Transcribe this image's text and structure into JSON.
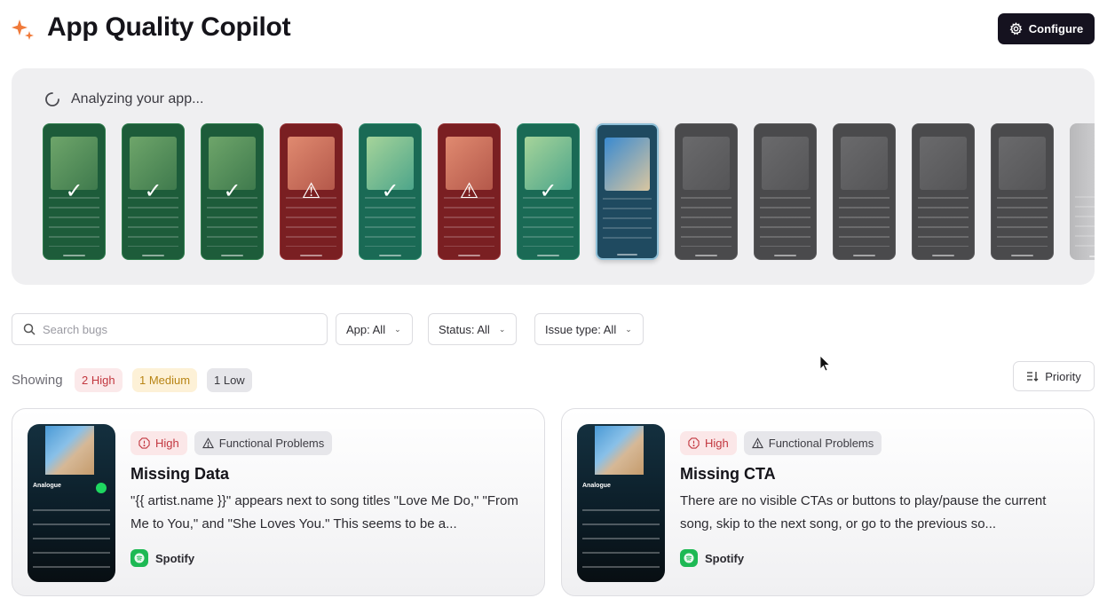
{
  "header": {
    "title": "App Quality Copilot",
    "logo_icon": "sparkle-icon",
    "configure_label": "Configure",
    "configure_icon": "gear-icon",
    "accent_color": "#f07a3a"
  },
  "analysis": {
    "label": "Analyzing your app...",
    "spinner_icon": "loading-spinner-icon",
    "screens": [
      {
        "status": "passed",
        "theme": "green",
        "mark": "✓"
      },
      {
        "status": "passed",
        "theme": "green",
        "mark": "✓"
      },
      {
        "status": "passed",
        "theme": "green",
        "mark": "✓"
      },
      {
        "status": "issue",
        "theme": "red",
        "mark": "⚠"
      },
      {
        "status": "passed",
        "theme": "teal",
        "mark": "✓"
      },
      {
        "status": "issue",
        "theme": "red",
        "mark": "⚠"
      },
      {
        "status": "passed",
        "theme": "teal",
        "mark": "✓"
      },
      {
        "status": "current",
        "theme": "blue",
        "mark": ""
      },
      {
        "status": "pending",
        "theme": "grey",
        "mark": ""
      },
      {
        "status": "pending",
        "theme": "grey",
        "mark": ""
      },
      {
        "status": "pending",
        "theme": "grey",
        "mark": ""
      },
      {
        "status": "pending",
        "theme": "grey",
        "mark": ""
      },
      {
        "status": "pending",
        "theme": "grey",
        "mark": ""
      },
      {
        "status": "pending",
        "theme": "fade",
        "mark": ""
      }
    ]
  },
  "filters": {
    "search_placeholder": "Search bugs",
    "search_value": "",
    "app": "App: All",
    "status": "Status: All",
    "issue_type": "Issue type: All"
  },
  "summary": {
    "showing_label": "Showing",
    "high": "2 High",
    "medium": "1 Medium",
    "low": "1 Low",
    "sort_label": "Priority",
    "sort_icon": "sort-descending-icon",
    "colors": {
      "high": "#c2373f",
      "medium": "#b88516",
      "low": "#3a3a40"
    }
  },
  "bugs": [
    {
      "severity": "High",
      "issue_type": "Functional Problems",
      "title": "Missing Data",
      "description": "\"{{ artist.name }}\" appears next to song titles \"Love Me Do,\" \"From Me to You,\" and \"She Loves You.\" This seems to be a...",
      "app": "Spotify",
      "thumb_title": "Analogue"
    },
    {
      "severity": "High",
      "issue_type": "Functional Problems",
      "title": "Missing CTA",
      "description": "There are no visible CTAs or buttons to play/pause the current song, skip to the next song, or go to the previous so...",
      "app": "Spotify",
      "thumb_title": "Analogue"
    }
  ]
}
